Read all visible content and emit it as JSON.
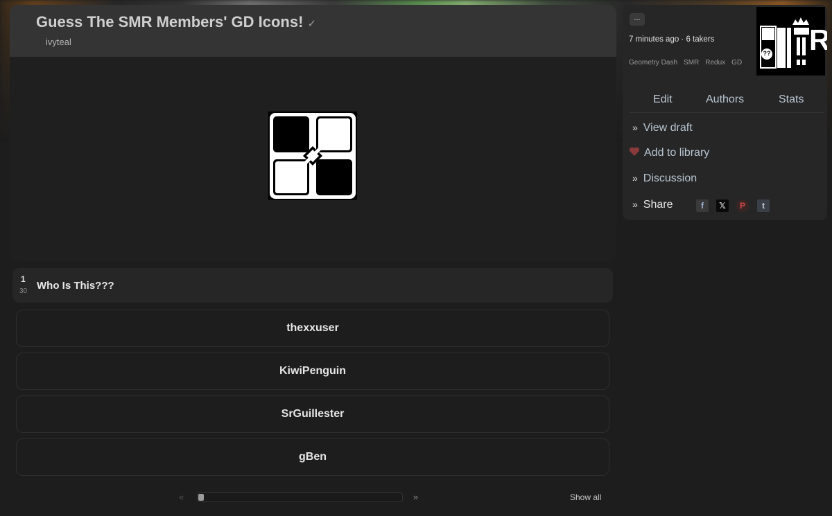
{
  "quiz": {
    "title": "Guess The SMR Members' GD Icons!",
    "author": "ivyteal",
    "image_icon": "gd-cube-icon"
  },
  "question": {
    "number": "1",
    "total": "30",
    "text": "Who Is This???"
  },
  "answers": [
    "thexxuser",
    "KiwiPenguin",
    "SrGuillester",
    "gBen"
  ],
  "pager": {
    "prev": "«",
    "next": "»",
    "show_all": "Show all",
    "progress_fraction": 0.03
  },
  "side": {
    "more": "...",
    "meta": "7 minutes ago · 6 takers",
    "tags": [
      "Geometry Dash",
      "SMR",
      "Redux",
      "GD"
    ],
    "tabs": [
      "Edit",
      "Authors",
      "Stats"
    ],
    "links": {
      "view_draft": "View draft",
      "add_to_library": "Add to library",
      "discussion": "Discussion",
      "share": "Share"
    },
    "link_marker": "»",
    "share_icons": [
      "facebook-icon",
      "x-icon",
      "pinterest-icon",
      "tumblr-icon"
    ],
    "thumbnail_text": "R",
    "thumbnail_badge": "??"
  },
  "colors": {
    "background": "#1d1d1d",
    "card": "#262626",
    "link": "#b9c6d2",
    "heart": "#8a3a3a"
  }
}
